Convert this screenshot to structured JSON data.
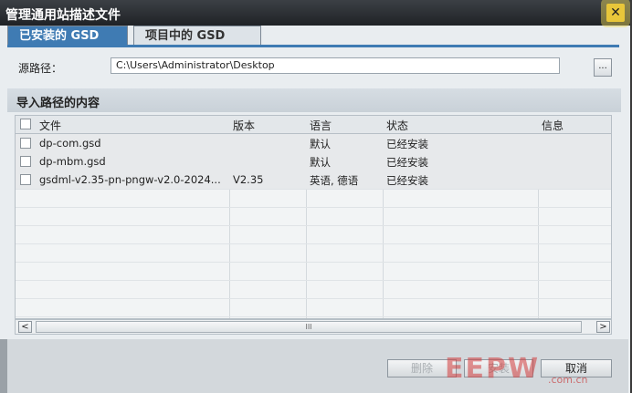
{
  "window": {
    "title": "管理通用站描述文件",
    "close_glyph": "✕"
  },
  "tabs": [
    {
      "label": "已安装的 GSD",
      "active": true
    },
    {
      "label": "项目中的 GSD",
      "active": false
    }
  ],
  "source": {
    "label": "源路径：",
    "value": "C:\\Users\\Administrator\\Desktop",
    "browse_label": "..."
  },
  "section": {
    "title": "导入路径的内容"
  },
  "table": {
    "columns": [
      "文件",
      "版本",
      "语言",
      "状态",
      "信息"
    ],
    "rows": [
      {
        "file": "dp-com.gsd",
        "version": "",
        "language": "默认",
        "status": "已经安装",
        "info": ""
      },
      {
        "file": "dp-mbm.gsd",
        "version": "",
        "language": "默认",
        "status": "已经安装",
        "info": ""
      },
      {
        "file": "gsdml-v2.35-pn-pngw-v2.0-2024...",
        "version": "V2.35",
        "language": "英语, 德语",
        "status": "已经安装",
        "info": ""
      }
    ]
  },
  "scrollbar": {
    "left_arrow": "<",
    "right_arrow": ">",
    "thumb_grip": "III"
  },
  "footer": {
    "delete_label": "删除",
    "install_label": "安装",
    "cancel_label": "取消"
  },
  "watermark": {
    "logo_text": "EEPW",
    "site": ".com.cn"
  }
}
